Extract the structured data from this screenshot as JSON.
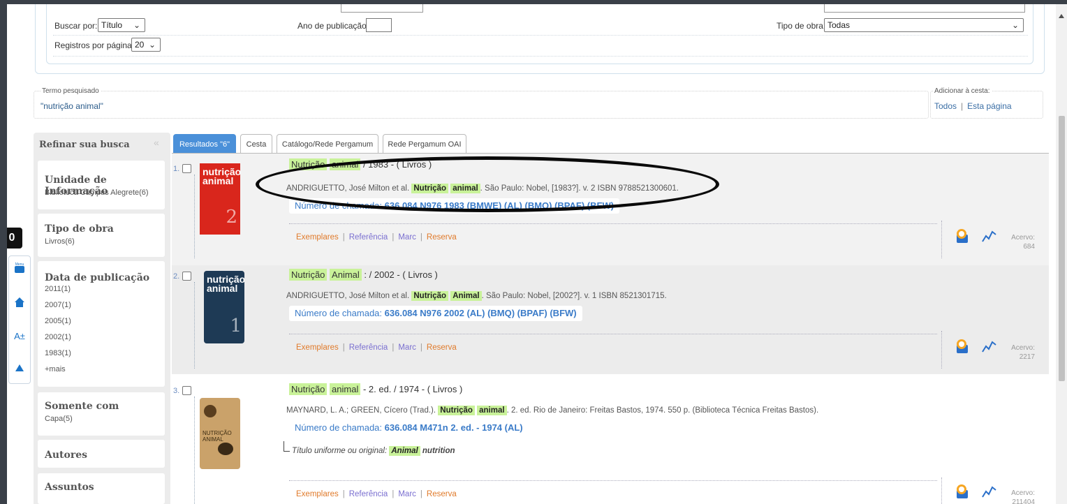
{
  "search_form": {
    "buscar_por_label": "Buscar por:",
    "buscar_por_value": "Título",
    "ano_label": "Ano de publicação:",
    "ano_value": "",
    "tipo_obra_label": "Tipo de obra:",
    "tipo_obra_value": "Todas",
    "registros_label": "Registros por página:",
    "registros_value": "20"
  },
  "term": {
    "label": "Termo pesquisado",
    "value": "\"nutrição animal\""
  },
  "cart": {
    "label": "Adicionar à cesta:",
    "all": "Todos",
    "separator": "|",
    "page": "Esta página"
  },
  "accessibility": {
    "contrast": "0",
    "icons": [
      "menu-icon",
      "home-icon",
      "font-size-icon",
      "go-top-icon"
    ],
    "font_label": "A±"
  },
  "refine": {
    "title": "Refinar sua busca",
    "collapse": "«",
    "facets": [
      {
        "title": "Unidade de Informação",
        "items": [
          "Biblioteca Câmpus Alegrete(6)"
        ]
      },
      {
        "title": "Tipo de obra",
        "items": [
          "Livros(6)"
        ]
      },
      {
        "title": "Data de publicação",
        "items": [
          "2011(1)",
          "2007(1)",
          "2005(1)",
          "2002(1)",
          "1983(1)",
          "+mais"
        ]
      },
      {
        "title": "Somente com",
        "items": [
          "Capa(5)"
        ]
      },
      {
        "title": "Autores",
        "items": []
      },
      {
        "title": "Assuntos",
        "items": []
      }
    ]
  },
  "tabs": [
    "Resultados \"6\"",
    "Cesta",
    "Catálogo/Rede Pergamum",
    "Rede Pergamum OAI"
  ],
  "results": [
    {
      "num": "1.",
      "cover_text": "nutrição animal",
      "cover_number": "2",
      "title_a": "Nutrição",
      "title_b": "animal",
      "title_rest": " / 1983 - ( Livros )",
      "author": "ANDRIGUETTO, José Milton et al.",
      "hl_a": "Nutrição",
      "hl_b": "animal",
      "imprint": ". São Paulo: Nobel, [1983?]. v. 2 ISBN 9788521300601.",
      "callno_label": "Número de chamada:",
      "callno_value": "636.084 N976 1983 (BMWE) (AL) (BMQ) (BPAF) (BFW)",
      "acervo_label": "Acervo:",
      "acervo_value": "684"
    },
    {
      "num": "2.",
      "cover_text": "nutrição animal",
      "cover_number": "1",
      "title_a": "Nutrição",
      "title_b": "Animal",
      "title_rest": " : / 2002 - ( Livros )",
      "author": "ANDRIGUETTO, José Milton et al.",
      "hl_a": "Nutrição",
      "hl_b": "Animal",
      "imprint": ". São Paulo: Nobel, [2002?]. v. 1 ISBN 8521301715.",
      "callno_label": "Número de chamada:",
      "callno_value": "636.084 N976 2002 (AL) (BMQ) (BPAF) (BFW)",
      "acervo_label": "Acervo:",
      "acervo_value": "2217"
    },
    {
      "num": "3.",
      "cover_text": "NUTRIÇÃO ANIMAL",
      "title_a": "Nutrição",
      "title_b": "animal",
      "title_rest": " - 2. ed. / 1974 - ( Livros )",
      "author": "MAYNARD, L. A.; GREEN, Cícero (Trad.).",
      "hl_a": "Nutrição",
      "hl_b": "animal",
      "imprint": ". 2. ed. Rio de Janeiro: Freitas Bastos, 1974. 550 p. (Biblioteca Técnica Freitas Bastos).",
      "callno_label": "Número de chamada:",
      "callno_value": "636.084 M471n 2. ed. - 1974 (AL)",
      "uniform_label": "Título uniforme ou original:",
      "uniform_hl": "Animal",
      "uniform_rest": "nutrition",
      "acervo_label": "Acervo:",
      "acervo_value": "211404"
    }
  ],
  "actions": {
    "exemplares": "Exemplares",
    "referencia": "Referência",
    "marc": "Marc",
    "reserva": "Reserva",
    "sep": "|"
  },
  "colors": {
    "accent_blue": "#4a90d9",
    "highlight_green": "#c9f299",
    "link_orange": "#e07a2a",
    "link_purple": "#7a6fd0"
  }
}
